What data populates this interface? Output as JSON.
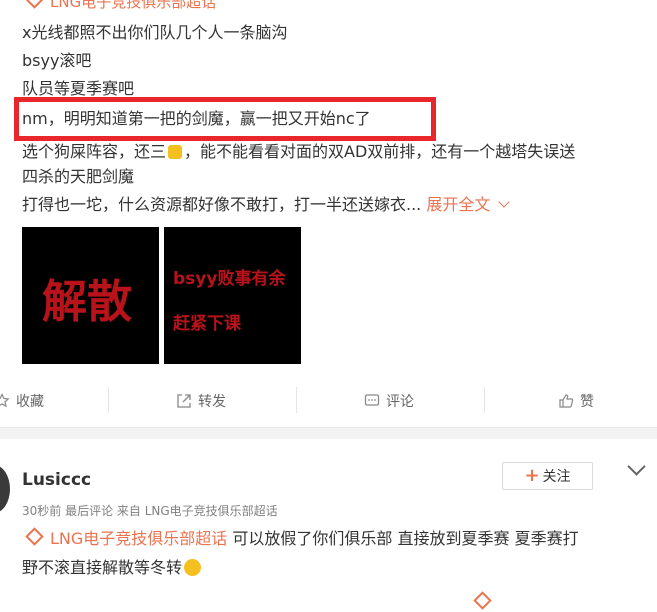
{
  "post1": {
    "topic_label": "LNG电子竞技俱乐部超话",
    "lines": [
      "x光线都照不出你们队几个人一条脑沟",
      "bsyy滚吧",
      "队员等夏季赛吧",
      "nm，明明知道第一把的剑魔，赢一把又开始nc了",
      "选个狗屎阵容，还三",
      "，能不能看看对面的双AD双前排，还有一个越塔失误送",
      "四杀的天肥剑魔",
      "打得也一坨，什么资源都好像不敢打，打一半还送嫁衣..."
    ],
    "expand_label": "展开全文",
    "images": [
      {
        "text": "解散"
      },
      {
        "line1": "bsyy败事有余",
        "line2": "赶紧下课"
      }
    ],
    "actions": {
      "collect": "收藏",
      "forward": "转发",
      "comment": "评论",
      "like": "赞"
    }
  },
  "post2": {
    "username": "Lusiccc",
    "follow_label": "关注",
    "meta": "30秒前  最后评论  来自 LNG电子竞技俱乐部超话",
    "topic_label": "LNG电子竞技俱乐部超话",
    "text_line1": "可以放假了你们俱乐部 直接放到夏季赛 夏季赛打",
    "text_line2": "野不滚直接解散等冬转"
  },
  "colors": {
    "accent": "#eb7350",
    "highlight_border": "#e8262b",
    "image_text_red": "#b8121b"
  }
}
